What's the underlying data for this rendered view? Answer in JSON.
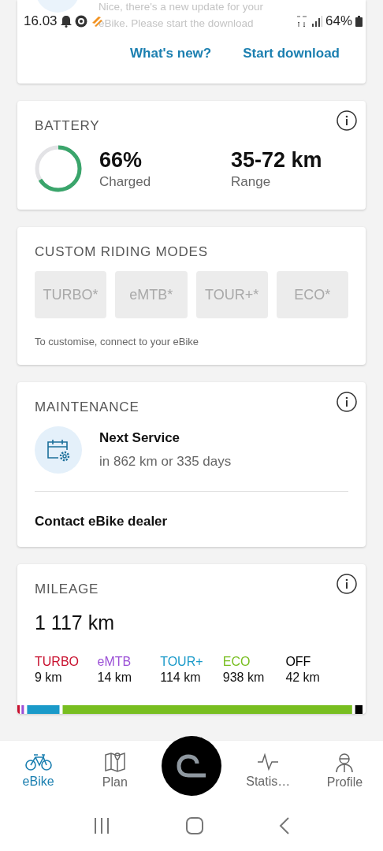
{
  "status_bar": {
    "time": "16.03",
    "battery": "64%"
  },
  "update_card": {
    "message": "Nice, there's a new update for your eBike. Please start the download",
    "actions": [
      "What's new?",
      "Start download"
    ]
  },
  "battery": {
    "title": "BATTERY",
    "level": 0.66,
    "charge": "66%",
    "charge_label": "Charged",
    "range": "35-72 km",
    "range_label": "Range"
  },
  "riding_modes": {
    "title": "CUSTOM RIDING MODES",
    "modes": [
      {
        "label": "TURBO*",
        "disabled": true
      },
      {
        "label": "eMTB*",
        "disabled": true
      },
      {
        "label": "TOUR+*",
        "disabled": true
      },
      {
        "label": "ECO*",
        "disabled": true
      }
    ],
    "hint": "To customise, connect to your eBike"
  },
  "maintenance": {
    "title": "MAINTENANCE",
    "service_title": "Next Service",
    "service_detail": "in 862 km or 335 days",
    "dealer_link": "Contact eBike dealer"
  },
  "mileage": {
    "title": "MILEAGE",
    "total": "1 117 km",
    "modes": [
      {
        "name": "TURBO",
        "distance": "9 km",
        "color": "#c8102e"
      },
      {
        "name": "eMTB",
        "distance": "14 km",
        "color": "#9b4fd6"
      },
      {
        "name": "TOUR+",
        "distance": "114 km",
        "color": "#1a9ac9"
      },
      {
        "name": "ECO",
        "distance": "938 km",
        "color": "#78be20"
      },
      {
        "name": "OFF",
        "distance": "42 km",
        "color": "#000000"
      }
    ]
  },
  "bottom_nav": [
    {
      "label": "eBike",
      "kind": "bike",
      "selected": true
    },
    {
      "label": "Plan",
      "kind": "map",
      "selected": false
    },
    {
      "label": "Statis…",
      "kind": "stats",
      "selected": false
    },
    {
      "label": "Profile",
      "kind": "profile",
      "selected": false
    }
  ]
}
